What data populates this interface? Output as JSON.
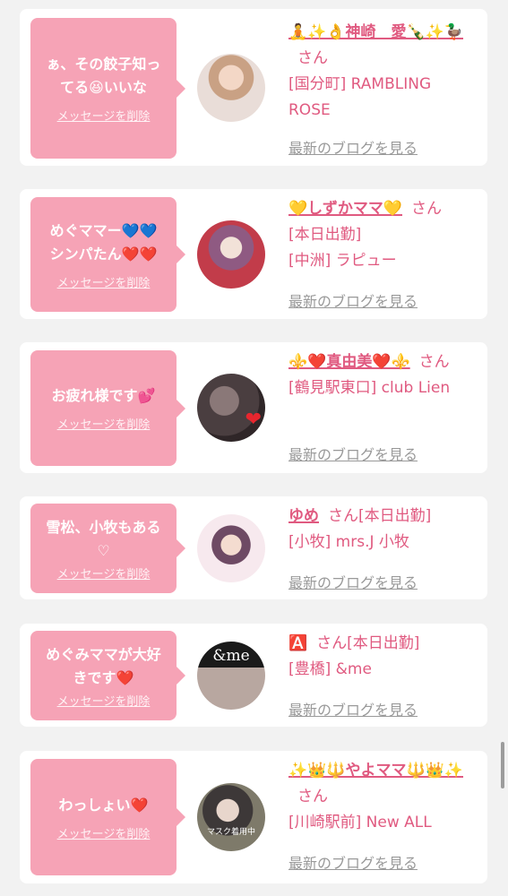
{
  "cards": [
    {
      "message_lines": [
        "ぁ、その餃子知っ",
        "てる😆いいな"
      ],
      "delete_label": "メッセージを削除",
      "name": "🧘✨👌神崎　愛🍾✨🦆",
      "san": "さん",
      "info_lines": [
        "[国分町] RAMBLING ROSE"
      ],
      "blog_label": "最新のブログを見る"
    },
    {
      "message_lines": [
        "めぐママー💙💙",
        "シンパたん❤️❤️"
      ],
      "delete_label": "メッセージを削除",
      "name": "💛しずかママ💛",
      "san": "さん",
      "info_lines": [
        "[本日出勤]",
        "[中洲] ラピュー"
      ],
      "blog_label": "最新のブログを見る"
    },
    {
      "message_lines": [
        "お疲れ様です💕"
      ],
      "delete_label": "メッセージを削除",
      "name": "⚜️❤️真由美❤️⚜️",
      "san": "さん",
      "info_lines": [
        "[鶴見駅東口] club Lien"
      ],
      "blog_label": "最新のブログを見る"
    },
    {
      "message_lines": [
        "雪松、小牧もある",
        "♡"
      ],
      "delete_label": "メッセージを削除",
      "name": "ゆめ",
      "san": "さん[本日出勤]",
      "info_lines": [
        "[小牧] mrs.J 小牧"
      ],
      "blog_label": "最新のブログを見る"
    },
    {
      "message_lines": [
        "めぐみママが大好",
        "きです❤️"
      ],
      "delete_label": "メッセージを削除",
      "name": "🅰️",
      "san": "さん[本日出勤]",
      "info_lines": [
        "[豊橋] &me"
      ],
      "blog_label": "最新のブログを見る"
    },
    {
      "message_lines": [
        "わっしょい❤️"
      ],
      "delete_label": "メッセージを削除",
      "name": "✨👑🔱やよママ🔱👑✨",
      "san": "さん",
      "info_lines": [
        "[川崎駅前] New ALL"
      ],
      "blog_label": "最新のブログを見る"
    }
  ],
  "avatar_texts": {
    "card5": "&me",
    "card6": "マスク着用中"
  },
  "colors": {
    "bubble": "#f6a3b6",
    "accent_text": "#e05a80",
    "muted_link": "#999999",
    "background": "#f2f2f2"
  }
}
